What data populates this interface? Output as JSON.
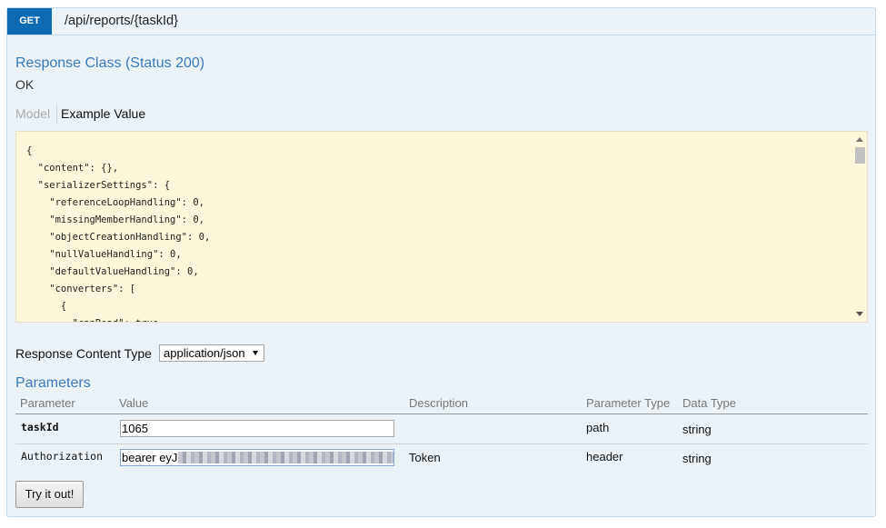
{
  "operation": {
    "method": "GET",
    "path": "/api/reports/{taskId}"
  },
  "response": {
    "title": "Response Class (Status 200)",
    "status_text": "OK",
    "tabs": {
      "model": "Model",
      "example": "Example Value"
    },
    "example_lines": [
      "{",
      "  \"content\": {},",
      "  \"serializerSettings\": {",
      "    \"referenceLoopHandling\": 0,",
      "    \"missingMemberHandling\": 0,",
      "    \"objectCreationHandling\": 0,",
      "    \"nullValueHandling\": 0,",
      "    \"defaultValueHandling\": 0,",
      "    \"converters\": [",
      "      {",
      "        \"canRead\": true,"
    ]
  },
  "content_type": {
    "label": "Response Content Type",
    "selected": "application/json"
  },
  "parameters": {
    "title": "Parameters",
    "headers": {
      "parameter": "Parameter",
      "value": "Value",
      "description": "Description",
      "parameter_type": "Parameter Type",
      "data_type": "Data Type"
    },
    "rows": [
      {
        "name": "taskId",
        "value": "1065",
        "description": "",
        "param_type": "path",
        "data_type": "string"
      },
      {
        "name": "Authorization",
        "value": "bearer eyJ",
        "description": "Token",
        "param_type": "header",
        "data_type": "string"
      }
    ]
  },
  "try_button": "Try it out!",
  "colors": {
    "get_verb": "#0f6ab4",
    "panel_bg": "#ebf3f9",
    "code_bg": "#fcf6db",
    "heading_blue": "#3a7ab8"
  }
}
